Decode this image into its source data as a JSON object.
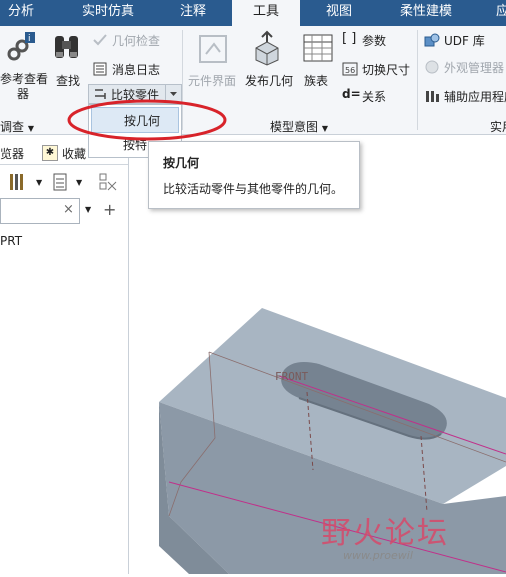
{
  "tabs": [
    {
      "label": "分析"
    },
    {
      "label": "实时仿真"
    },
    {
      "label": "注释"
    },
    {
      "label": "工具"
    },
    {
      "label": "视图"
    },
    {
      "label": "柔性建模"
    },
    {
      "label": "应"
    }
  ],
  "ribbon": {
    "investigate": {
      "reference_viewer": "参考查看\n器",
      "find": "查找",
      "geometry_check": "几何检查",
      "message_log": "消息日志",
      "compare_part": "比较零件",
      "group_label": "调查"
    },
    "model_intent": {
      "component_interface": "元件界面",
      "publish_geometry": "发布几何",
      "family_table": "族表",
      "parameters": "参数",
      "switch_dimensions": "切换尺寸",
      "relations": "关系",
      "group_label": "模型意图"
    },
    "utilities": {
      "udf_library": "UDF 库",
      "appearance_manager": "外观管理器",
      "aux_app": "辅助应用程序",
      "group_label": "实用"
    }
  },
  "dropdown": {
    "items": [
      {
        "label": "按几何"
      },
      {
        "label": "按特"
      }
    ]
  },
  "tooltip": {
    "title": "按几何",
    "description": "比较活动零件与其他零件的几何。"
  },
  "navigator": {
    "tab_browser": "览器",
    "tab_favorites": "收藏",
    "model_item": "PRT"
  },
  "viewport": {
    "datum_label": "FRONT"
  },
  "watermark": {
    "text": "野火论坛",
    "url": "www.proewil"
  },
  "colors": {
    "tabbar": "#2a5b8f",
    "ribbon": "#f4f6f9",
    "highlight_circle": "#d8232a",
    "model_face": "#a9b6c3"
  }
}
